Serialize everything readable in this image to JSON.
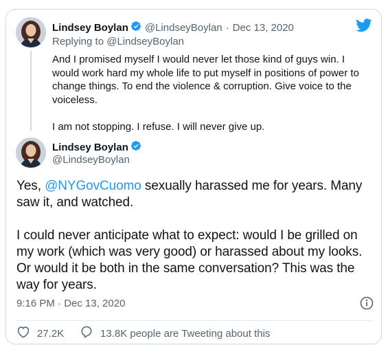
{
  "colors": {
    "accent": "#1d9bf0",
    "muted": "#536471",
    "text": "#0f1419",
    "border": "#cfd9de"
  },
  "reply_tweet": {
    "author_name": "Lindsey Boylan",
    "handle": "@LindseyBoylan",
    "separator": "·",
    "date": "Dec 13, 2020",
    "replying_prefix": "Replying to",
    "replying_to": "@LindseyBoylan",
    "paragraphs": [
      "And I promised myself I would never let those kind of guys win. I would work hard my whole life to put myself in positions of power to change things. To end the violence & corruption. Give voice to the voiceless.",
      "I am not stopping. I refuse. I will never give up."
    ]
  },
  "main_tweet": {
    "author_name": "Lindsey Boylan",
    "handle": "@LindseyBoylan",
    "p1_before": "Yes, ",
    "mention": "@NYGovCuomo",
    "p1_after": " sexually harassed me for years. Many saw it, and watched.",
    "p2": "I could never anticipate what to expect: would I be grilled on my work (which was very good) or harassed about my looks. Or would it be both in the same conversation? This was the way for years.",
    "time": "9:16 PM · Dec 13, 2020"
  },
  "actions": {
    "likes": "27.2K",
    "tweeting_about": "13.8K people are Tweeting about this"
  },
  "icons": [
    "twitter-bird-icon",
    "verified-badge-icon",
    "info-icon",
    "heart-icon",
    "reply-bubble-icon"
  ]
}
